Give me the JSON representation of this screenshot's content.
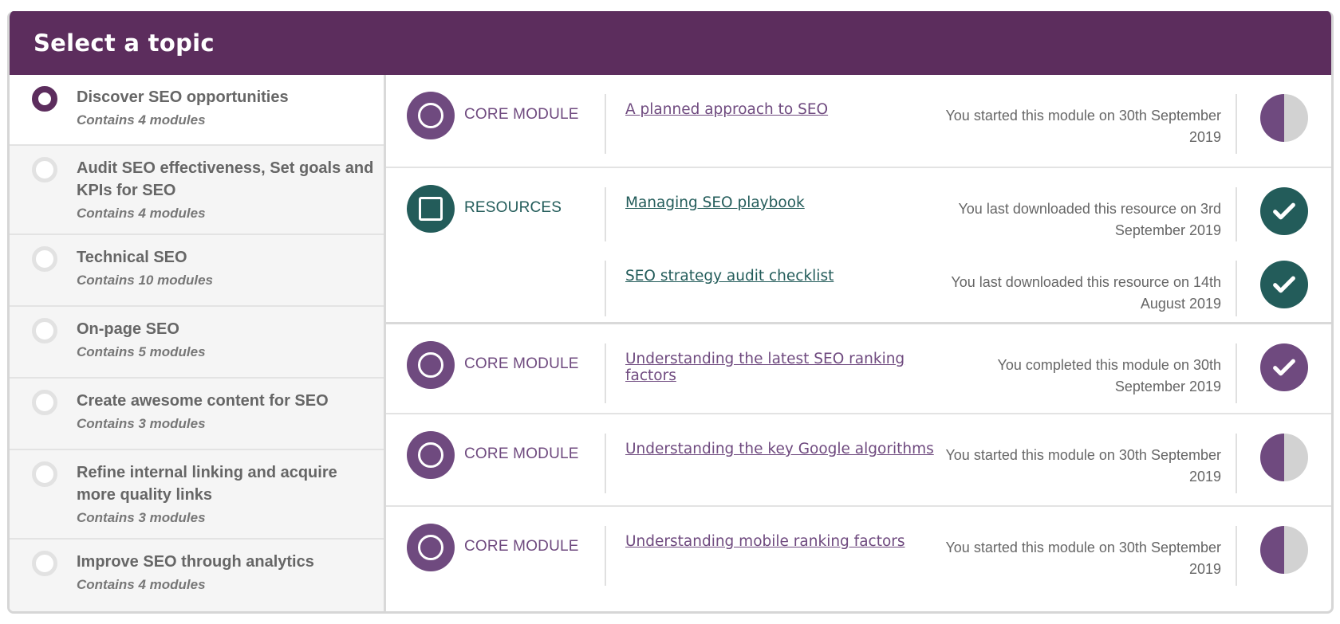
{
  "header": {
    "title": "Select a topic"
  },
  "topics": [
    {
      "title": "Discover SEO opportunities",
      "subtitle": "Contains 4 modules",
      "active": true
    },
    {
      "title": "Audit SEO effectiveness, Set goals and KPIs for SEO",
      "subtitle": "Contains 4 modules"
    },
    {
      "title": "Technical SEO",
      "subtitle": "Contains 10 modules"
    },
    {
      "title": "On-page SEO",
      "subtitle": "Contains 5 modules"
    },
    {
      "title": "Create awesome content for SEO",
      "subtitle": "Contains 3 modules"
    },
    {
      "title": "Refine internal linking and acquire more quality links",
      "subtitle": "Contains 3 modules"
    },
    {
      "title": "Improve SEO through analytics",
      "subtitle": "Contains 4 modules"
    }
  ],
  "modules": [
    {
      "type_label": "CORE MODULE",
      "type_icon": "core-module-icon",
      "items": [
        {
          "link": "A planned approach to SEO",
          "status": "You started this module on 30th September 2019",
          "state": "half-progress-icon"
        }
      ]
    },
    {
      "type_label": "RESOURCES",
      "type_icon": "resource-icon",
      "items": [
        {
          "link": "Managing SEO playbook",
          "status": "You last downloaded this resource on 3rd September 2019",
          "state": "check-icon"
        },
        {
          "link": "SEO strategy audit checklist",
          "status": "You last downloaded this resource on 14th August 2019",
          "state": "check-icon"
        }
      ]
    },
    {
      "type_label": "CORE MODULE",
      "type_icon": "core-module-icon",
      "items": [
        {
          "link": "Understanding the latest SEO ranking factors",
          "status": "You completed this module on 30th September 2019",
          "state": "check-icon"
        }
      ]
    },
    {
      "type_label": "CORE MODULE",
      "type_icon": "core-module-icon",
      "items": [
        {
          "link": "Understanding the key Google algorithms",
          "status": "You started this module on 30th September 2019",
          "state": "half-progress-icon"
        }
      ]
    },
    {
      "type_label": "CORE MODULE",
      "type_icon": "core-module-icon",
      "items": [
        {
          "link": "Understanding mobile ranking factors",
          "status": "You started this module on 30th September 2019",
          "state": "half-progress-icon"
        }
      ]
    }
  ],
  "colors": {
    "header": "#5c2d5d",
    "core": "#6f4a7f",
    "resource": "#235c5a",
    "inactive": "#d2d2d2"
  }
}
